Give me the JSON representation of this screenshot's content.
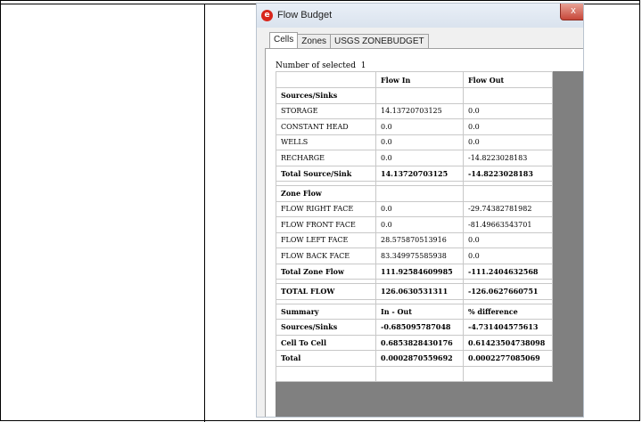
{
  "window": {
    "title": "Flow Budget",
    "close_glyph": "x",
    "icon": "app-logo-icon"
  },
  "tabs": [
    {
      "label": "Cells",
      "active": true
    },
    {
      "label": "Zones",
      "active": false
    },
    {
      "label": "USGS ZONEBUDGET",
      "active": false
    }
  ],
  "selection": {
    "label": "Number of selected",
    "count": "1"
  },
  "grid": {
    "columns": [
      "",
      "Flow In",
      "Flow Out"
    ],
    "rows": [
      {
        "kind": "bold",
        "cells": [
          "Sources/Sinks",
          "",
          ""
        ]
      },
      {
        "kind": "normal",
        "cells": [
          "STORAGE",
          "14.13720703125",
          "0.0"
        ]
      },
      {
        "kind": "normal",
        "cells": [
          "CONSTANT HEAD",
          "0.0",
          "0.0"
        ]
      },
      {
        "kind": "normal",
        "cells": [
          "WELLS",
          "0.0",
          "0.0"
        ]
      },
      {
        "kind": "normal",
        "cells": [
          "RECHARGE",
          "0.0",
          "-14.8223028183"
        ]
      },
      {
        "kind": "bold",
        "cells": [
          "Total Source/Sink",
          "14.13720703125",
          "-14.8223028183"
        ]
      },
      {
        "kind": "spacer",
        "cells": [
          "",
          "",
          ""
        ]
      },
      {
        "kind": "bold",
        "cells": [
          "Zone Flow",
          "",
          ""
        ]
      },
      {
        "kind": "normal",
        "cells": [
          "FLOW RIGHT FACE",
          "0.0",
          "-29.74382781982"
        ]
      },
      {
        "kind": "normal",
        "cells": [
          "FLOW FRONT FACE",
          "0.0",
          "-81.49663543701"
        ]
      },
      {
        "kind": "normal",
        "cells": [
          "FLOW LEFT FACE",
          "28.575870513916",
          "0.0"
        ]
      },
      {
        "kind": "normal",
        "cells": [
          "FLOW BACK FACE",
          "83.349975585938",
          "0.0"
        ]
      },
      {
        "kind": "bold",
        "cells": [
          "Total Zone Flow",
          "111.92584609985",
          "-111.2404632568"
        ]
      },
      {
        "kind": "spacer",
        "cells": [
          "",
          "",
          ""
        ]
      },
      {
        "kind": "bold",
        "cells": [
          "TOTAL FLOW",
          "126.0630531311",
          "-126.0627660751"
        ]
      },
      {
        "kind": "spacer",
        "cells": [
          "",
          "",
          ""
        ]
      },
      {
        "kind": "bold",
        "cells": [
          "Summary",
          "In - Out",
          "% difference"
        ]
      },
      {
        "kind": "bold",
        "cells": [
          "Sources/Sinks",
          "-0.685095787048",
          "-4.731404575613"
        ]
      },
      {
        "kind": "bold",
        "cells": [
          "Cell To Cell",
          "0.6853828430176",
          "0.61423504738098"
        ]
      },
      {
        "kind": "bold",
        "cells": [
          "Total",
          "0.0002870559692",
          "0.0002277085069"
        ]
      },
      {
        "kind": "normal",
        "cells": [
          "",
          "",
          ""
        ]
      }
    ]
  }
}
